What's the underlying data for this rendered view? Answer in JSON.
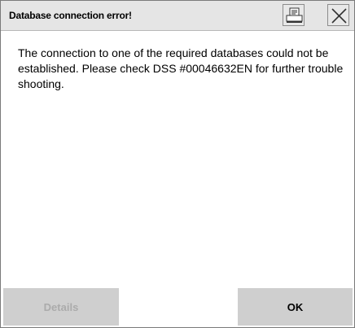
{
  "dialog": {
    "title": "Database connection error!",
    "message": "The connection to one of the required databases could not be established. Please check DSS #00046632EN for further trouble shooting.",
    "print_icon": "printer-icon",
    "close_icon": "close-icon"
  },
  "buttons": {
    "details_label": "Details",
    "details_enabled": false,
    "ok_label": "OK"
  },
  "colors": {
    "titlebar": "#e5e5e5",
    "button_bg": "#cfcfcf",
    "disabled_text": "#ababab"
  }
}
